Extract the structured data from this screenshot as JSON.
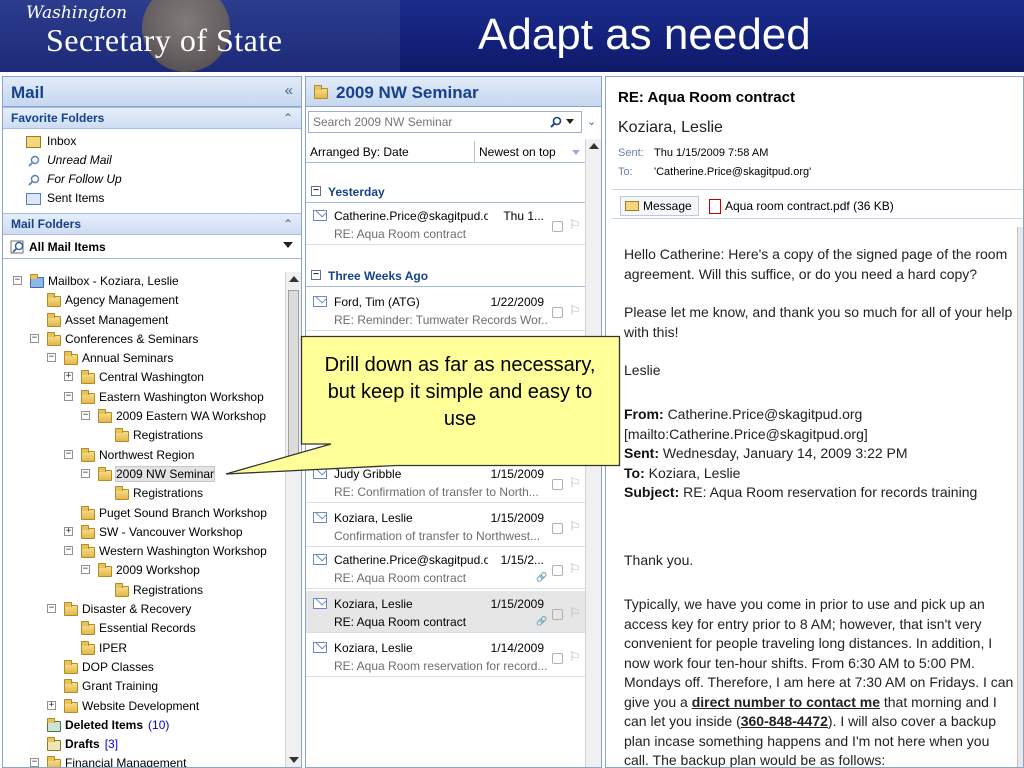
{
  "banner": {
    "logo_script": "Washington",
    "logo_main": "Secretary of State",
    "title": "Adapt as needed",
    "colors": {
      "background": "#13207a",
      "title": "#ffffff"
    }
  },
  "nav": {
    "title": "Mail",
    "collapse_glyph": "«",
    "favorite_folders": {
      "title": "Favorite Folders",
      "items": [
        {
          "label": "Inbox",
          "icon": "inbox-icon"
        },
        {
          "label": "Unread Mail",
          "icon": "search-folder-icon"
        },
        {
          "label": "For Follow Up",
          "icon": "search-folder-icon"
        },
        {
          "label": "Sent Items",
          "icon": "sent-items-icon"
        }
      ]
    },
    "mail_folders": {
      "title": "Mail Folders",
      "all_items": "All Mail Items"
    },
    "tree": [
      {
        "label": "Mailbox - Koziara, Leslie",
        "toggle": "−"
      },
      {
        "label": "Agency Management"
      },
      {
        "label": "Asset Management"
      },
      {
        "label": "Conferences & Seminars",
        "toggle": "−"
      },
      {
        "label": "Annual Seminars",
        "toggle": "−"
      },
      {
        "label": "Central Washington",
        "toggle": "+"
      },
      {
        "label": "Eastern Washington Workshop",
        "toggle": "−"
      },
      {
        "label": "2009 Eastern WA Workshop",
        "toggle": "−"
      },
      {
        "label": "Registrations"
      },
      {
        "label": "Northwest Region",
        "toggle": "−"
      },
      {
        "label": "2009 NW Seminar",
        "toggle": "−",
        "selected": true
      },
      {
        "label": "Registrations"
      },
      {
        "label": "Puget Sound Branch Workshop"
      },
      {
        "label": "SW - Vancouver Workshop",
        "toggle": "+"
      },
      {
        "label": "Western Washington Workshop",
        "toggle": "−"
      },
      {
        "label": "2009 Workshop",
        "toggle": "−"
      },
      {
        "label": "Registrations"
      },
      {
        "label": "Disaster & Recovery",
        "toggle": "−"
      },
      {
        "label": "Essential Records"
      },
      {
        "label": "IPER"
      },
      {
        "label": "DOP Classes"
      },
      {
        "label": "Grant Training"
      },
      {
        "label": "Website Development",
        "toggle": "+"
      },
      {
        "label": "Deleted Items",
        "count": "(10)"
      },
      {
        "label": "Drafts",
        "count": "[3]"
      },
      {
        "label": "Financial Management",
        "toggle": "−"
      }
    ]
  },
  "list": {
    "title": "2009 NW Seminar",
    "search_placeholder": "Search 2009 NW Seminar",
    "arranged_by": "Arranged By: Date",
    "sort": "Newest on top",
    "groups": [
      {
        "label": "Yesterday"
      },
      {
        "label": "Three Weeks Ago"
      }
    ],
    "messages": [
      {
        "from": "Catherine.Price@skagitpud.org",
        "date": "Thu 1...",
        "subject": "RE: Aqua Room contract"
      },
      {
        "from": "Ford, Tim (ATG)",
        "date": "1/22/2009",
        "subject": "RE: Reminder: Tumwater Records Wor..."
      },
      {
        "from": "Judy Gribble",
        "date": "1/15/2009",
        "subject": "RE: Confirmation of transfer to North..."
      },
      {
        "from": "Koziara, Leslie",
        "date": "1/15/2009",
        "subject": "Confirmation of transfer to Northwest..."
      },
      {
        "from": "Catherine.Price@skagitpud.org",
        "date": "1/15/2...",
        "subject": "RE: Aqua Room contract"
      },
      {
        "from": "Koziara, Leslie",
        "date": "1/15/2009",
        "subject": "RE: Aqua Room contract"
      },
      {
        "from": "Koziara, Leslie",
        "date": "1/14/2009",
        "subject": "RE: Aqua Room reservation for record..."
      }
    ]
  },
  "reading": {
    "subject": "RE: Aqua Room contract",
    "from": "Koziara, Leslie",
    "sent_label": "Sent:",
    "sent": "Thu 1/15/2009 7:58 AM",
    "to_label": "To:",
    "to": "'Catherine.Price@skagitpud.org'",
    "tab_message": "Message",
    "attachment": "Aqua room contract.pdf (36 KB)",
    "para1": "Hello Catherine:  Here's a copy of the signed page of the room agreement.  Will this suffice, or do you need a hard copy?",
    "para2": "Please let me know, and thank you so much for all of your help with this!",
    "sig": "Leslie",
    "q_from_label": "From:",
    "q_from": "Catherine.Price@skagitpud.org",
    "q_mailto": "[mailto:Catherine.Price@skagitpud.org]",
    "q_sent_label": "Sent:",
    "q_sent": "Wednesday, January 14, 2009 3:22 PM",
    "q_to_label": "To:",
    "q_to": "Koziara, Leslie",
    "q_subject_label": "Subject:",
    "q_subject": "RE: Aqua Room reservation for records training",
    "thanks": "Thank you.",
    "p3a": "Typically, we have you come in prior to use and pick up an access key for entry prior to 8 AM; however, that isn't very convenient for people traveling long distances.  In addition, I now work four ten-hour shifts.  From 6:30 AM to 5:00 PM.  Mondays off.  Therefore, I am here at 7:30 AM on Fridays.  I can give you a ",
    "p3_link": "direct number to contact me",
    "p3b": " that morning and I can let you inside (",
    "p3_phone": "360-848-4472",
    "p3c": ").  I will also cover a backup plan incase something happens and I'm not here when you call.  The backup plan would be as follows:"
  },
  "callout": {
    "text": "Drill down as far as necessary, but keep it simple and easy to use",
    "colors": {
      "fill": "#ffff99",
      "stroke": "#333333"
    }
  }
}
